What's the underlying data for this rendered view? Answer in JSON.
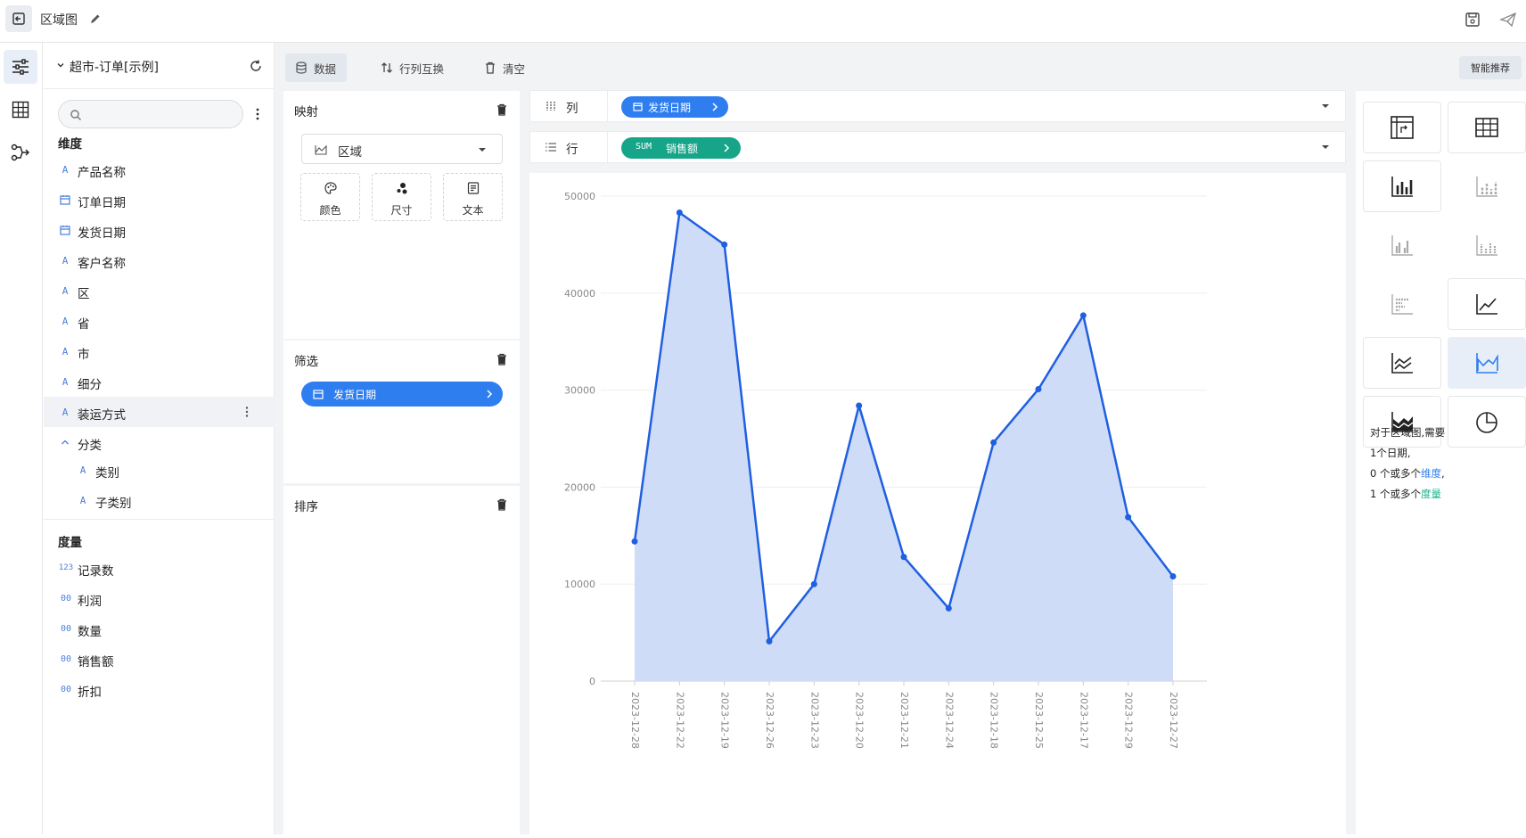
{
  "header": {
    "title": "区域图"
  },
  "datasource": {
    "name": "超市-订单[示例]",
    "search_placeholder": ""
  },
  "dimensions": {
    "title": "维度",
    "items": [
      {
        "type": "A",
        "label": "产品名称"
      },
      {
        "type": "date",
        "label": "订单日期"
      },
      {
        "type": "date",
        "label": "发货日期"
      },
      {
        "type": "A",
        "label": "客户名称"
      },
      {
        "type": "A",
        "label": "区"
      },
      {
        "type": "A",
        "label": "省"
      },
      {
        "type": "A",
        "label": "市"
      },
      {
        "type": "A",
        "label": "细分"
      },
      {
        "type": "A",
        "label": "装运方式"
      }
    ],
    "group": {
      "label": "分类",
      "children": [
        {
          "type": "A",
          "label": "类别"
        },
        {
          "type": "A",
          "label": "子类别"
        }
      ]
    }
  },
  "measures": {
    "title": "度量",
    "items": [
      {
        "type": "123",
        "label": "记录数"
      },
      {
        "type": "00",
        "label": "利润"
      },
      {
        "type": "00",
        "label": "数量"
      },
      {
        "type": "00",
        "label": "销售额"
      },
      {
        "type": "00",
        "label": "折扣"
      }
    ]
  },
  "toolbar": {
    "data_label": "数据",
    "swap_label": "行列互换",
    "clear_label": "清空",
    "smart_label": "智能推荐"
  },
  "mapping": {
    "title": "映射",
    "mark_type": "区域",
    "color_label": "颜色",
    "size_label": "尺寸",
    "text_label": "文本"
  },
  "filter": {
    "title": "筛选",
    "pill": "发货日期"
  },
  "sort": {
    "title": "排序"
  },
  "shelves": {
    "columns_label": "列",
    "columns_pill": "发货日期",
    "rows_label": "行",
    "rows_agg": "SUM",
    "rows_pill": "销售额"
  },
  "hint": {
    "line1": "对于区域图,需要",
    "line2": "1个日期,",
    "line3_prefix": "0 个或多个",
    "line3_link": "维度",
    "line3_suffix": ",",
    "line4_prefix": "1 个或多个",
    "line4_link": "度量"
  },
  "colors": {
    "accent": "#2e7ef0",
    "measure_pill": "#16a589",
    "area_fill": "#cfdcf8",
    "line": "#1f5fe0"
  },
  "chart_data": {
    "type": "area",
    "x": [
      "2023-12-28",
      "2023-12-22",
      "2023-12-19",
      "2023-12-26",
      "2023-12-23",
      "2023-12-20",
      "2023-12-21",
      "2023-12-24",
      "2023-12-18",
      "2023-12-25",
      "2023-12-17",
      "2023-12-29",
      "2023-12-27"
    ],
    "values": [
      14400,
      48300,
      45000,
      4100,
      10000,
      28400,
      12800,
      7500,
      24600,
      30100,
      37700,
      16900,
      10800
    ],
    "ylim": [
      0,
      50000
    ],
    "yticks": [
      0,
      10000,
      20000,
      30000,
      40000,
      50000
    ],
    "grid": true
  }
}
